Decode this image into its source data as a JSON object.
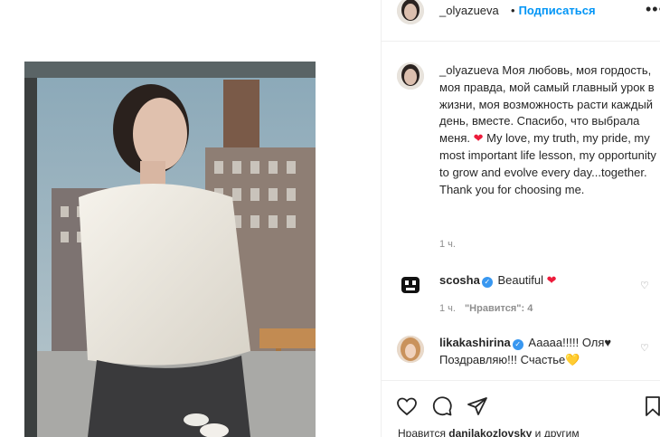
{
  "post": {
    "header": {
      "username": "_olyazueva",
      "dot": "•",
      "follow_label": "Подписаться",
      "more_label": "•••"
    },
    "caption": {
      "username": "_olyazueva",
      "text_ru": "Моя любовь, моя гордость, моя правда, мой самый главный урок в жизни, моя возможность расти каждый день, вместе. Спасибо, что выбрала меня.",
      "heart": "❤",
      "text_en": "My love, my truth, my pride, my most important life lesson, my opportunity to grow and evolve every day...together. Thank you for choosing me.",
      "time": "1 ч."
    },
    "comments": [
      {
        "username": "scosha",
        "text": "Beautiful",
        "emoji": "❤",
        "time": "1 ч.",
        "likes": "\"Нравится\": 4",
        "reply": ""
      },
      {
        "username": "likakashirina",
        "text": "Ааааа!!!!! Оля",
        "emoji": "♥",
        "text2": "Поздравляю!!! Счастье",
        "emoji2": "💛"
      }
    ],
    "likers_prefix": "Нравится ",
    "likers_user": "danilakozlovsky",
    "likers_suffix": " и другим",
    "colors": {
      "accent": "#0095f6",
      "heart": "#ed1b3b",
      "verified": "#3897f0",
      "muted": "#8e8e8e"
    }
  }
}
